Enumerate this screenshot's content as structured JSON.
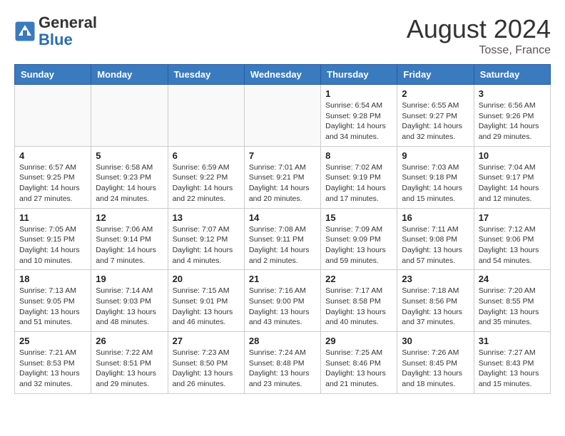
{
  "header": {
    "logo_general": "General",
    "logo_blue": "Blue",
    "month_title": "August 2024",
    "location": "Tosse, France"
  },
  "weekdays": [
    "Sunday",
    "Monday",
    "Tuesday",
    "Wednesday",
    "Thursday",
    "Friday",
    "Saturday"
  ],
  "weeks": [
    [
      {
        "day": "",
        "info": ""
      },
      {
        "day": "",
        "info": ""
      },
      {
        "day": "",
        "info": ""
      },
      {
        "day": "",
        "info": ""
      },
      {
        "day": "1",
        "info": "Sunrise: 6:54 AM\nSunset: 9:28 PM\nDaylight: 14 hours\nand 34 minutes."
      },
      {
        "day": "2",
        "info": "Sunrise: 6:55 AM\nSunset: 9:27 PM\nDaylight: 14 hours\nand 32 minutes."
      },
      {
        "day": "3",
        "info": "Sunrise: 6:56 AM\nSunset: 9:26 PM\nDaylight: 14 hours\nand 29 minutes."
      }
    ],
    [
      {
        "day": "4",
        "info": "Sunrise: 6:57 AM\nSunset: 9:25 PM\nDaylight: 14 hours\nand 27 minutes."
      },
      {
        "day": "5",
        "info": "Sunrise: 6:58 AM\nSunset: 9:23 PM\nDaylight: 14 hours\nand 24 minutes."
      },
      {
        "day": "6",
        "info": "Sunrise: 6:59 AM\nSunset: 9:22 PM\nDaylight: 14 hours\nand 22 minutes."
      },
      {
        "day": "7",
        "info": "Sunrise: 7:01 AM\nSunset: 9:21 PM\nDaylight: 14 hours\nand 20 minutes."
      },
      {
        "day": "8",
        "info": "Sunrise: 7:02 AM\nSunset: 9:19 PM\nDaylight: 14 hours\nand 17 minutes."
      },
      {
        "day": "9",
        "info": "Sunrise: 7:03 AM\nSunset: 9:18 PM\nDaylight: 14 hours\nand 15 minutes."
      },
      {
        "day": "10",
        "info": "Sunrise: 7:04 AM\nSunset: 9:17 PM\nDaylight: 14 hours\nand 12 minutes."
      }
    ],
    [
      {
        "day": "11",
        "info": "Sunrise: 7:05 AM\nSunset: 9:15 PM\nDaylight: 14 hours\nand 10 minutes."
      },
      {
        "day": "12",
        "info": "Sunrise: 7:06 AM\nSunset: 9:14 PM\nDaylight: 14 hours\nand 7 minutes."
      },
      {
        "day": "13",
        "info": "Sunrise: 7:07 AM\nSunset: 9:12 PM\nDaylight: 14 hours\nand 4 minutes."
      },
      {
        "day": "14",
        "info": "Sunrise: 7:08 AM\nSunset: 9:11 PM\nDaylight: 14 hours\nand 2 minutes."
      },
      {
        "day": "15",
        "info": "Sunrise: 7:09 AM\nSunset: 9:09 PM\nDaylight: 13 hours\nand 59 minutes."
      },
      {
        "day": "16",
        "info": "Sunrise: 7:11 AM\nSunset: 9:08 PM\nDaylight: 13 hours\nand 57 minutes."
      },
      {
        "day": "17",
        "info": "Sunrise: 7:12 AM\nSunset: 9:06 PM\nDaylight: 13 hours\nand 54 minutes."
      }
    ],
    [
      {
        "day": "18",
        "info": "Sunrise: 7:13 AM\nSunset: 9:05 PM\nDaylight: 13 hours\nand 51 minutes."
      },
      {
        "day": "19",
        "info": "Sunrise: 7:14 AM\nSunset: 9:03 PM\nDaylight: 13 hours\nand 48 minutes."
      },
      {
        "day": "20",
        "info": "Sunrise: 7:15 AM\nSunset: 9:01 PM\nDaylight: 13 hours\nand 46 minutes."
      },
      {
        "day": "21",
        "info": "Sunrise: 7:16 AM\nSunset: 9:00 PM\nDaylight: 13 hours\nand 43 minutes."
      },
      {
        "day": "22",
        "info": "Sunrise: 7:17 AM\nSunset: 8:58 PM\nDaylight: 13 hours\nand 40 minutes."
      },
      {
        "day": "23",
        "info": "Sunrise: 7:18 AM\nSunset: 8:56 PM\nDaylight: 13 hours\nand 37 minutes."
      },
      {
        "day": "24",
        "info": "Sunrise: 7:20 AM\nSunset: 8:55 PM\nDaylight: 13 hours\nand 35 minutes."
      }
    ],
    [
      {
        "day": "25",
        "info": "Sunrise: 7:21 AM\nSunset: 8:53 PM\nDaylight: 13 hours\nand 32 minutes."
      },
      {
        "day": "26",
        "info": "Sunrise: 7:22 AM\nSunset: 8:51 PM\nDaylight: 13 hours\nand 29 minutes."
      },
      {
        "day": "27",
        "info": "Sunrise: 7:23 AM\nSunset: 8:50 PM\nDaylight: 13 hours\nand 26 minutes."
      },
      {
        "day": "28",
        "info": "Sunrise: 7:24 AM\nSunset: 8:48 PM\nDaylight: 13 hours\nand 23 minutes."
      },
      {
        "day": "29",
        "info": "Sunrise: 7:25 AM\nSunset: 8:46 PM\nDaylight: 13 hours\nand 21 minutes."
      },
      {
        "day": "30",
        "info": "Sunrise: 7:26 AM\nSunset: 8:45 PM\nDaylight: 13 hours\nand 18 minutes."
      },
      {
        "day": "31",
        "info": "Sunrise: 7:27 AM\nSunset: 8:43 PM\nDaylight: 13 hours\nand 15 minutes."
      }
    ]
  ]
}
